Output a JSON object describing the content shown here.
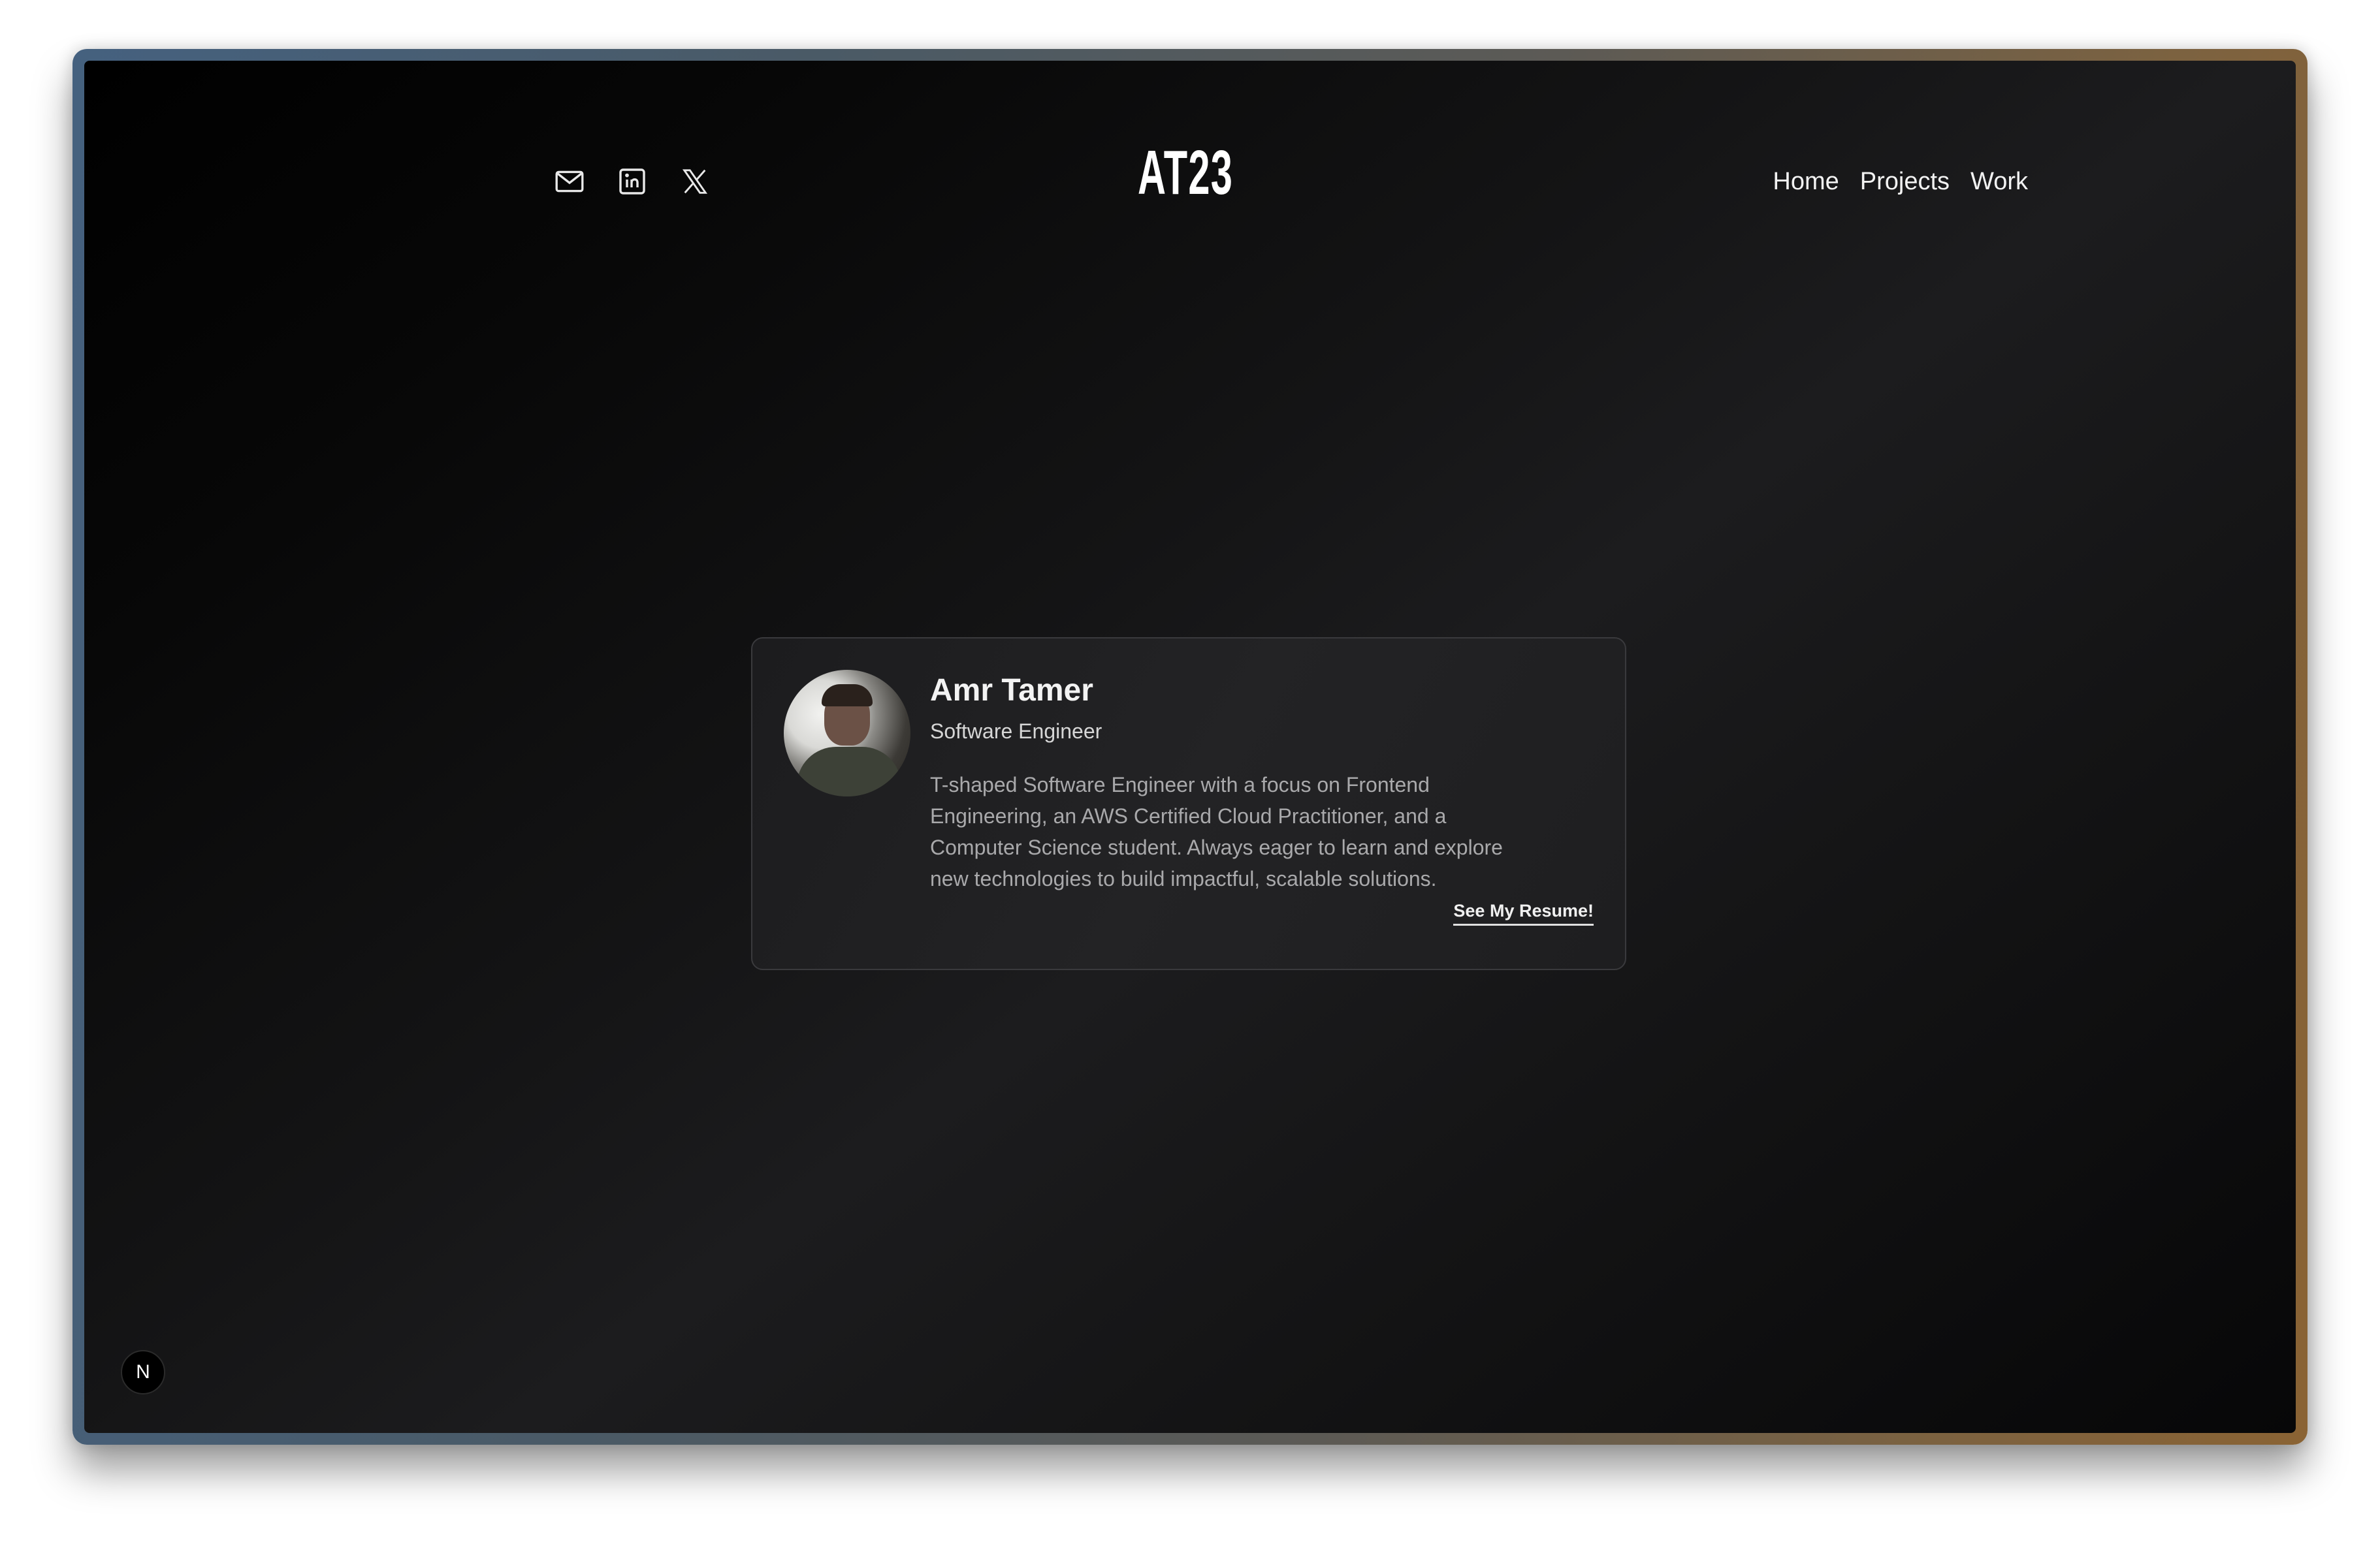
{
  "header": {
    "logo": "AT23",
    "social": [
      {
        "icon": "mail-icon"
      },
      {
        "icon": "linkedin-icon"
      },
      {
        "icon": "x-icon"
      }
    ],
    "nav": [
      "Home",
      "Projects",
      "Work"
    ]
  },
  "profile": {
    "name": "Amr Tamer",
    "role": "Software Engineer",
    "bio": "T-shaped Software Engineer with a focus on Frontend Engineering, an AWS Certified Cloud Practitioner, and a Computer Science student. Always eager to learn and explore new technologies to build impactful, scalable solutions.",
    "resume_label": "See My Resume!"
  },
  "dev_badge": {
    "label": "N"
  },
  "colors": {
    "background": "#0d0d0e",
    "card": "#202022",
    "text": "#f3f3f3",
    "muted": "#a9a9ab"
  }
}
